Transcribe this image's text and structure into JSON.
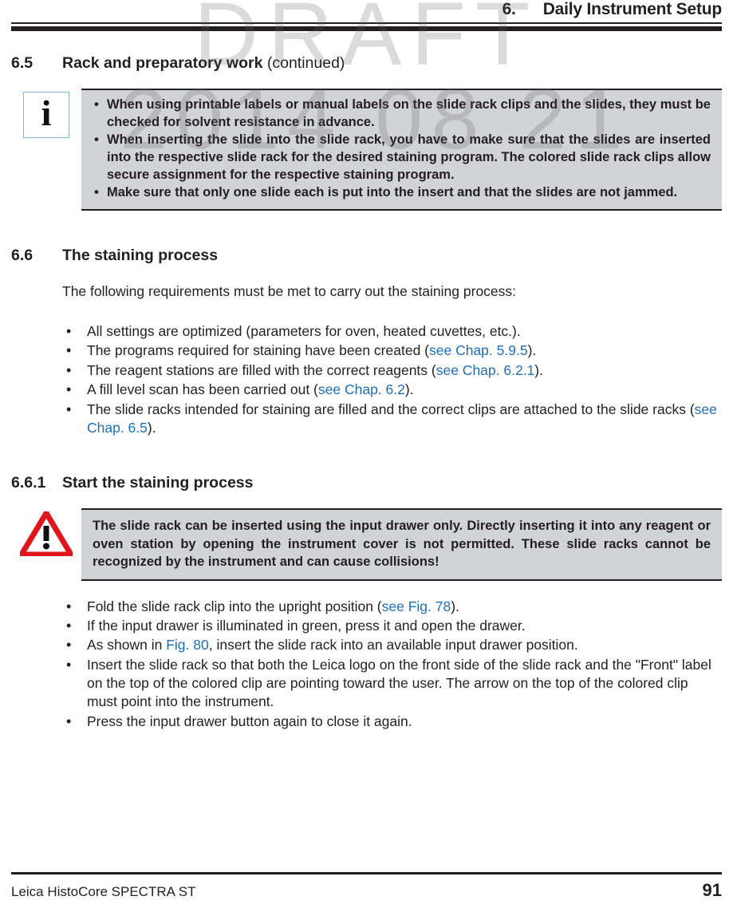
{
  "watermark": {
    "line1": "DRAFT",
    "line2": "2014 08 21"
  },
  "header": {
    "chapter_number": "6.",
    "chapter_title": "Daily Instrument Setup"
  },
  "sections": {
    "s65": {
      "number": "6.5",
      "title": "Rack and preparatory work",
      "title_suffix": "(continued)"
    },
    "s66": {
      "number": "6.6",
      "title": "The staining process",
      "intro": "The following requirements must be met to carry out the staining process:"
    },
    "s661": {
      "number": "6.6.1",
      "title": "Start the staining process"
    }
  },
  "note_box": {
    "icon": "info-icon",
    "icon_glyph": "i",
    "bullets": [
      "When using printable labels or manual labels on the slide rack clips and the slides, they must be checked for solvent resistance in advance.",
      "When inserting the slide into the slide rack, you have to make sure that the slides are inserted into the respective slide rack for the desired staining program. The colored slide rack clips allow secure assignment for the respective staining program.",
      "Make sure that only one slide each is put into the insert and that the slides are not jammed."
    ]
  },
  "warning_box": {
    "icon": "warning-triangle-icon",
    "text": "The slide rack can be inserted using the input drawer only. Directly inserting it into any reagent or oven station by opening the instrument cover is not permitted. These slide racks cannot be recognized by the instrument and can cause collisions!"
  },
  "requirements_list": [
    {
      "text_before": "All settings are optimized (parameters for oven, heated cuvettes, etc.).",
      "xref": "",
      "text_after": ""
    },
    {
      "text_before": "The programs required for staining have been created (",
      "xref": "see Chap. 5.9.5",
      "text_after": ")."
    },
    {
      "text_before": "The reagent stations are filled with the correct reagents (",
      "xref": "see Chap. 6.2.1",
      "text_after": ")."
    },
    {
      "text_before": "A fill level scan has been carried out (",
      "xref": "see Chap. 6.2",
      "text_after": ")."
    },
    {
      "text_before": "The slide racks intended for staining are filled and the correct clips are attached to the slide racks (",
      "xref": "see Chap. 6.5",
      "text_after": ")."
    }
  ],
  "steps_list": [
    {
      "text_before": "Fold the slide rack clip into the upright position (",
      "xref": "see Fig. 78",
      "text_after": ")."
    },
    {
      "text_before": "If the input drawer is illuminated in green, press it and open the drawer.",
      "xref": "",
      "text_after": ""
    },
    {
      "text_before": "As shown in ",
      "xref": "Fig. 80",
      "text_after": ", insert the slide rack into an available input drawer position."
    },
    {
      "text_before": "Insert the slide rack so that both the Leica logo on the front side of the slide rack and the \"Front\" label on the top of the colored clip are pointing toward the user. The arrow on the top of the colored clip must point into the instrument.",
      "xref": "",
      "text_after": ""
    },
    {
      "text_before": "Press the input drawer button again to close it again.",
      "xref": "",
      "text_after": ""
    }
  ],
  "footer": {
    "product": "Leica HistoCore SPECTRA ST",
    "page_number": "91"
  },
  "colors": {
    "xref_blue": "#1f6fb5",
    "callout_gray": "#d2d3d4",
    "rule_black": "#231f20",
    "warning_red": "#e1161c",
    "info_border_blue": "#7fb8e0"
  }
}
